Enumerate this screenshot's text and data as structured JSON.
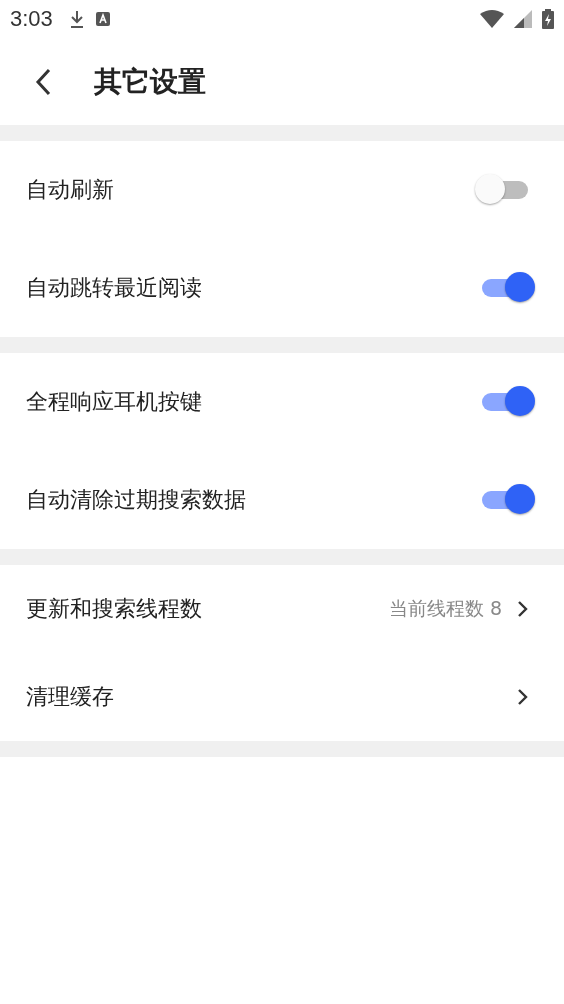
{
  "status_bar": {
    "time": "3:03"
  },
  "header": {
    "title": "其它设置"
  },
  "sections": [
    {
      "items": [
        {
          "kind": "toggle",
          "label": "自动刷新",
          "on": false
        },
        {
          "kind": "toggle",
          "label": "自动跳转最近阅读",
          "on": true
        }
      ]
    },
    {
      "items": [
        {
          "kind": "toggle",
          "label": "全程响应耳机按键",
          "on": true
        },
        {
          "kind": "toggle",
          "label": "自动清除过期搜索数据",
          "on": true
        }
      ]
    },
    {
      "items": [
        {
          "kind": "link",
          "label": "更新和搜索线程数",
          "value": "当前线程数 8"
        },
        {
          "kind": "link",
          "label": "清理缓存"
        }
      ]
    }
  ]
}
